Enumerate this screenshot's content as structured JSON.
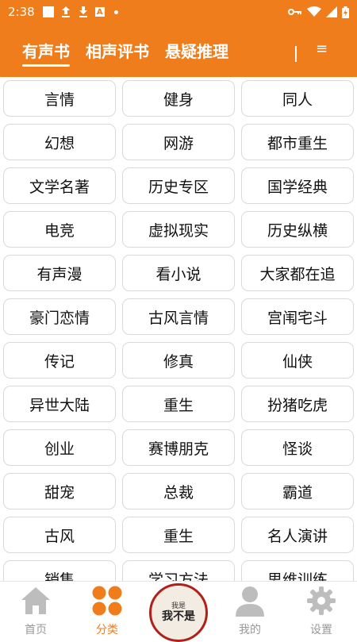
{
  "status_bar": {
    "time": "2:38"
  },
  "tabs": [
    {
      "label": "有声书",
      "active": true
    },
    {
      "label": "相声评书",
      "active": false
    },
    {
      "label": "悬疑推理",
      "active": false
    }
  ],
  "categories": [
    "言情",
    "健身",
    "同人",
    "幻想",
    "网游",
    "都市重生",
    "文学名著",
    "历史专区",
    "国学经典",
    "电竞",
    "虚拟现实",
    "历史纵横",
    "有声漫",
    "看小说",
    "大家都在追",
    "豪门恋情",
    "古风言情",
    "宫闱宅斗",
    "传记",
    "修真",
    "仙侠",
    "异世大陆",
    "重生",
    "扮猪吃虎",
    "创业",
    "赛博朋克",
    "怪谈",
    "甜宠",
    "总裁",
    "霸道",
    "古风",
    "重生",
    "名人演讲",
    "销售",
    "学习方法",
    "思维训练"
  ],
  "bottom_nav": {
    "home": "首页",
    "category": "分类",
    "mine": "我的",
    "settings": "设置",
    "promo": {
      "top": "我是",
      "main": "我不是",
      "sub": ""
    }
  },
  "colors": {
    "accent": "#ef7d1b",
    "nav_inactive": "#999999",
    "promo_border": "#b1211b"
  }
}
